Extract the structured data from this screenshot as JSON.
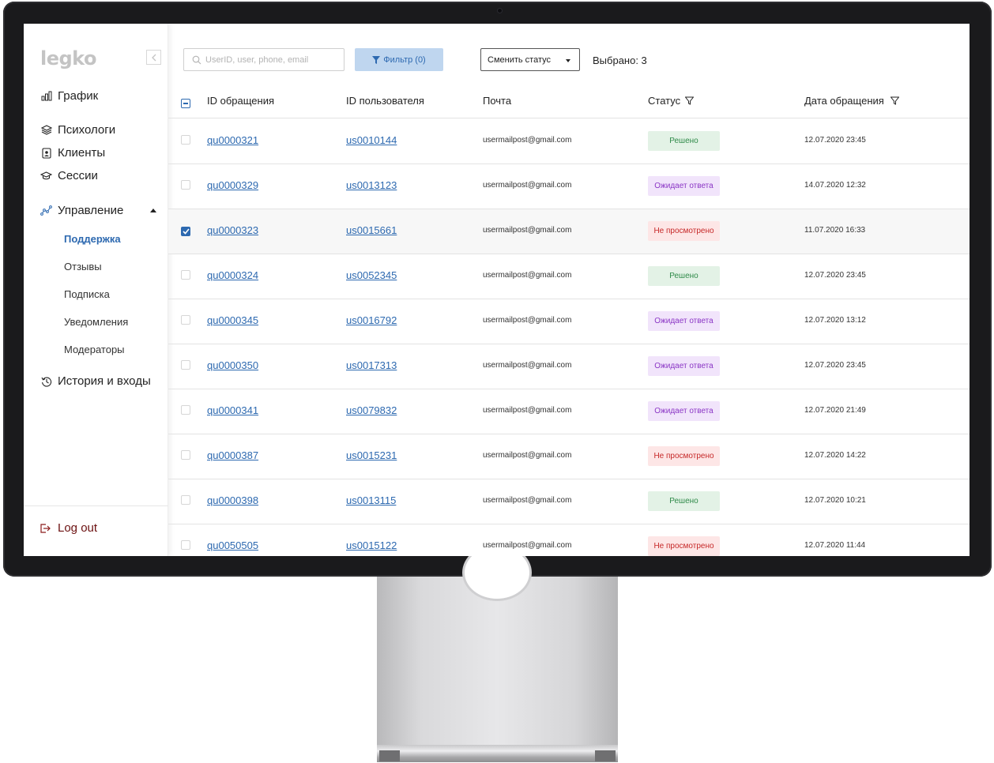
{
  "sidebar": {
    "logo": "legko",
    "nav": {
      "grafik": "График",
      "psychologists": "Психологи",
      "clients": "Клиенты",
      "sessions": "Сессии",
      "management": "Управление",
      "history": "История и входы"
    },
    "sub": {
      "support": "Поддержка",
      "reviews": "Отзывы",
      "subscription": "Подписка",
      "notifications": "Уведомления",
      "moderators": "Модераторы"
    },
    "logout": "Log out"
  },
  "toolbar": {
    "search_placeholder": "UserID, user, phone, email",
    "filter_label": "Фильтр (0)",
    "status_select": "Сменить статус",
    "selected": "Выбрано: 3"
  },
  "table": {
    "headers": {
      "request_id": "ID обращения",
      "user_id": "ID пользователя",
      "email": "Почта",
      "status": "Статус",
      "date": "Дата обращения"
    },
    "rows": [
      {
        "request_id": "qu0000321",
        "user_id": "us0010144",
        "email": "usermailpost@gmail.com",
        "status": "Решено",
        "status_type": "resolved",
        "date": "12.07.2020  23:45",
        "checked": false
      },
      {
        "request_id": "qu0000329",
        "user_id": "us0013123",
        "email": "usermailpost@gmail.com",
        "status": "Ожидает ответа",
        "status_type": "waiting",
        "date": "14.07.2020  12:32",
        "checked": false
      },
      {
        "request_id": "qu0000323",
        "user_id": "us0015661",
        "email": "usermailpost@gmail.com",
        "status": "Не просмотрено",
        "status_type": "unseen",
        "date": "11.07.2020  16:33",
        "checked": true
      },
      {
        "request_id": "qu0000324",
        "user_id": "us0052345",
        "email": "usermailpost@gmail.com",
        "status": "Решено",
        "status_type": "resolved",
        "date": "12.07.2020  23:45",
        "checked": false
      },
      {
        "request_id": "qu0000345",
        "user_id": "us0016792",
        "email": "usermailpost@gmail.com",
        "status": "Ожидает ответа",
        "status_type": "waiting",
        "date": "12.07.2020  13:12",
        "checked": false
      },
      {
        "request_id": "qu0000350",
        "user_id": "us0017313",
        "email": "usermailpost@gmail.com",
        "status": "Ожидает ответа",
        "status_type": "waiting",
        "date": "12.07.2020  23:45",
        "checked": false
      },
      {
        "request_id": "qu0000341",
        "user_id": "us0079832",
        "email": "usermailpost@gmail.com",
        "status": "Ожидает ответа",
        "status_type": "waiting",
        "date": "12.07.2020  21:49",
        "checked": false
      },
      {
        "request_id": "qu0000387",
        "user_id": "us0015231",
        "email": "usermailpost@gmail.com",
        "status": "Не просмотрено",
        "status_type": "unseen",
        "date": "12.07.2020  14:22",
        "checked": false
      },
      {
        "request_id": "qu0000398",
        "user_id": "us0013115",
        "email": "usermailpost@gmail.com",
        "status": "Решено",
        "status_type": "resolved",
        "date": "12.07.2020  10:21",
        "checked": false
      },
      {
        "request_id": "qu0050505",
        "user_id": "us0015122",
        "email": "usermailpost@gmail.com",
        "status": "Не просмотрено",
        "status_type": "unseen",
        "date": "12.07.2020  11:44",
        "checked": false
      }
    ]
  },
  "colors": {
    "accent": "#2d69b0",
    "resolved_bg": "#e3f2e6",
    "resolved_fg": "#2f8a49",
    "waiting_bg": "#f1e4fb",
    "waiting_fg": "#8a35c5",
    "unseen_bg": "#fde6e6",
    "unseen_fg": "#c62828"
  }
}
